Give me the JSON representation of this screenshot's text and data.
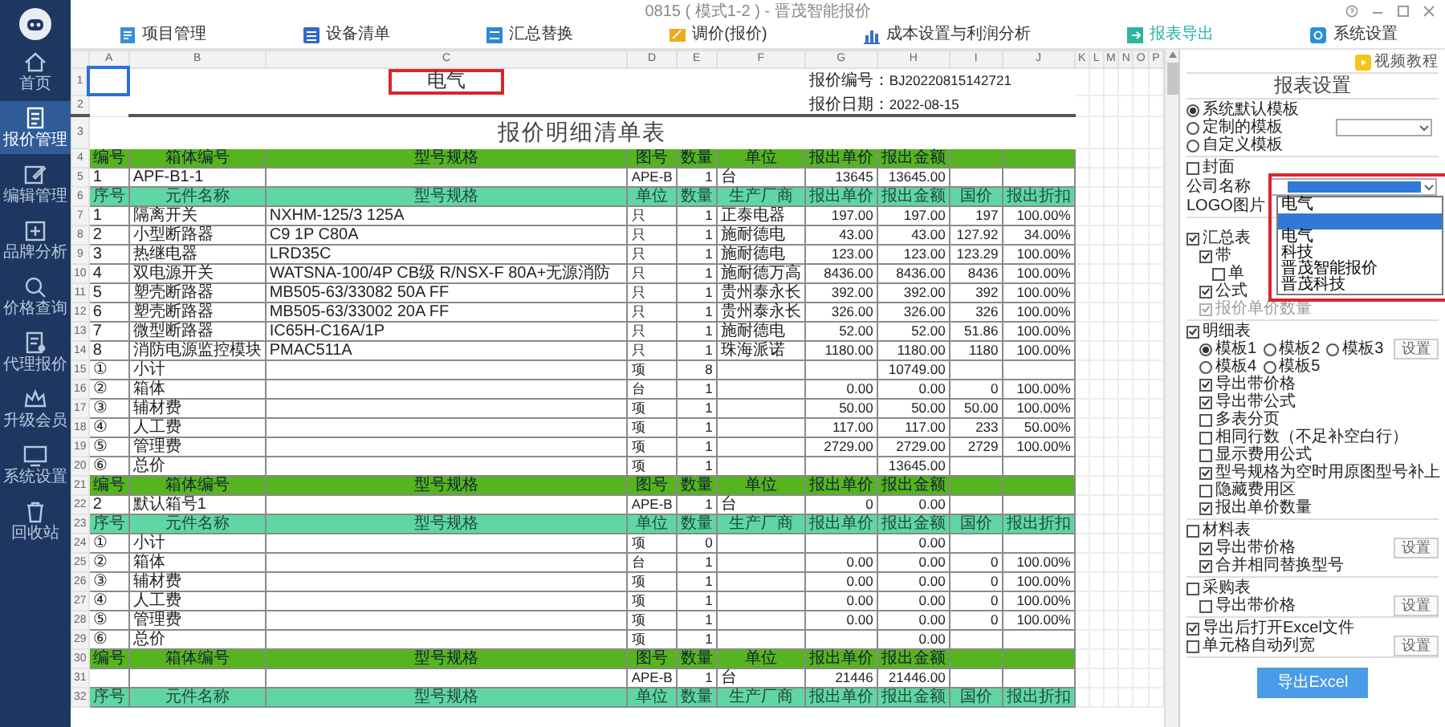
{
  "window": {
    "title": "0815 ( 模式1-2 ) - 晋茂智能报价"
  },
  "sidebar": {
    "items": [
      {
        "label": "首页",
        "selected": false
      },
      {
        "label": "报价管理",
        "selected": true
      },
      {
        "label": "编辑管理",
        "selected": false
      },
      {
        "label": "品牌分析",
        "selected": false
      },
      {
        "label": "价格查询",
        "selected": false
      },
      {
        "label": "代理报价",
        "selected": false
      },
      {
        "label": "升级会员",
        "selected": false
      },
      {
        "label": "系统设置",
        "selected": false
      },
      {
        "label": "回收站",
        "selected": false
      }
    ]
  },
  "toolbar": {
    "items": [
      {
        "label": "项目管理",
        "selected": false
      },
      {
        "label": "设备清单",
        "selected": false
      },
      {
        "label": "汇总替换",
        "selected": false
      },
      {
        "label": "调价(报价)",
        "selected": false
      },
      {
        "label": "成本设置与利润分析",
        "selected": false
      },
      {
        "label": "报表导出",
        "selected": true
      },
      {
        "label": "系统设置",
        "selected": false
      }
    ]
  },
  "sheet": {
    "column_letters": [
      "A",
      "B",
      "C",
      "D",
      "E",
      "F",
      "G",
      "H",
      "I",
      "J",
      "K",
      "L",
      "M",
      "N",
      "O",
      "P"
    ],
    "heading_row_numbers": [
      "1",
      "2",
      "3"
    ],
    "company_name": "电气",
    "quote_no_label": "报价编号：",
    "quote_no": "BJ20220815142721",
    "quote_date_label": "报价日期：",
    "quote_date": "2022-08-15",
    "title": "报价明细清单表",
    "rows": [
      {
        "number": "4",
        "kind": "box-header",
        "cells": {
          "A": "编号",
          "B": "箱体编号",
          "C": "型号规格",
          "D": "图号",
          "E": "数量",
          "F": "单位",
          "G": "报出单价",
          "H": "报出金额"
        }
      },
      {
        "number": "5",
        "kind": "data",
        "cells": {
          "A": "1",
          "B": "APF-B1-1",
          "D": "APE-B",
          "E": "1",
          "F": "台",
          "G": "13645",
          "H": "13645.00"
        }
      },
      {
        "number": "6",
        "kind": "item-header",
        "cells": {
          "A": "序号",
          "B": "元件名称",
          "C": "型号规格",
          "D": "单位",
          "E": "数量",
          "F": "生产厂商",
          "G": "报出单价",
          "H": "报出金额",
          "I": "国价",
          "J": "报出折扣"
        }
      },
      {
        "number": "7",
        "kind": "data",
        "cells": {
          "A": "1",
          "B": "隔离开关",
          "C": "NXHM-125/3 125A",
          "D": "只",
          "E": "1",
          "F": "正泰电器",
          "G": "197.00",
          "H": "197.00",
          "I": "197",
          "J": "100.00%"
        }
      },
      {
        "number": "8",
        "kind": "data",
        "cells": {
          "A": "2",
          "B": "小型断路器",
          "C": "C9 1P C80A",
          "D": "只",
          "E": "1",
          "F": "施耐德电",
          "G": "43.00",
          "H": "43.00",
          "I": "127.92",
          "J": "34.00%"
        }
      },
      {
        "number": "9",
        "kind": "data",
        "cells": {
          "A": "3",
          "B": "热继电器",
          "C": "LRD35C",
          "D": "只",
          "E": "1",
          "F": "施耐德电",
          "G": "123.00",
          "H": "123.00",
          "I": "123.29",
          "J": "100.00%"
        }
      },
      {
        "number": "10",
        "kind": "data",
        "cells": {
          "A": "4",
          "B": "双电源开关",
          "C": "WATSNA-100/4P CB级 R/NSX-F 80A+无源消防",
          "D": "只",
          "E": "1",
          "F": "施耐德万高",
          "G": "8436.00",
          "H": "8436.00",
          "I": "8436",
          "J": "100.00%"
        }
      },
      {
        "number": "11",
        "kind": "data",
        "cells": {
          "A": "5",
          "B": "塑壳断路器",
          "C": "MB505-63/33082 50A FF",
          "D": "只",
          "E": "1",
          "F": "贵州泰永长",
          "G": "392.00",
          "H": "392.00",
          "I": "392",
          "J": "100.00%"
        }
      },
      {
        "number": "12",
        "kind": "data",
        "cells": {
          "A": "6",
          "B": "塑壳断路器",
          "C": "MB505-63/33002 20A FF",
          "D": "只",
          "E": "1",
          "F": "贵州泰永长",
          "G": "326.00",
          "H": "326.00",
          "I": "326",
          "J": "100.00%"
        }
      },
      {
        "number": "13",
        "kind": "data",
        "cells": {
          "A": "7",
          "B": "微型断路器",
          "C": "IC65H-C16A/1P",
          "D": "只",
          "E": "1",
          "F": "施耐德电",
          "G": "52.00",
          "H": "52.00",
          "I": "51.86",
          "J": "100.00%"
        }
      },
      {
        "number": "14",
        "kind": "data",
        "cells": {
          "A": "8",
          "B": "消防电源监控模块",
          "C": "PMAC511A",
          "D": "只",
          "E": "1",
          "F": "珠海派诺",
          "G": "1180.00",
          "H": "1180.00",
          "I": "1180",
          "J": "100.00%"
        }
      },
      {
        "number": "15",
        "kind": "data",
        "cells": {
          "A": "①",
          "B": "小计",
          "D": "项",
          "E": "8",
          "H": "10749.00"
        }
      },
      {
        "number": "16",
        "kind": "data",
        "cells": {
          "A": "②",
          "B": "箱体",
          "D": "台",
          "E": "1",
          "G": "0.00",
          "H": "0.00",
          "I": "0",
          "J": "100.00%"
        }
      },
      {
        "number": "17",
        "kind": "data",
        "cells": {
          "A": "③",
          "B": "辅材费",
          "D": "项",
          "E": "1",
          "G": "50.00",
          "H": "50.00",
          "I": "50.00",
          "J": "100.00%"
        }
      },
      {
        "number": "18",
        "kind": "data",
        "cells": {
          "A": "④",
          "B": "人工费",
          "D": "项",
          "E": "1",
          "G": "117.00",
          "H": "117.00",
          "I": "233",
          "J": "50.00%"
        }
      },
      {
        "number": "19",
        "kind": "data",
        "cells": {
          "A": "⑤",
          "B": "管理费",
          "D": "项",
          "E": "1",
          "G": "2729.00",
          "H": "2729.00",
          "I": "2729",
          "J": "100.00%"
        }
      },
      {
        "number": "20",
        "kind": "data",
        "cells": {
          "A": "⑥",
          "B": "总价",
          "D": "项",
          "E": "1",
          "H": "13645.00"
        }
      },
      {
        "number": "21",
        "kind": "box-header",
        "cells": {
          "A": "编号",
          "B": "箱体编号",
          "C": "型号规格",
          "D": "图号",
          "E": "数量",
          "F": "单位",
          "G": "报出单价",
          "H": "报出金额"
        }
      },
      {
        "number": "22",
        "kind": "data",
        "cells": {
          "A": "2",
          "B": "默认箱号1",
          "D": "APE-B",
          "E": "1",
          "F": "台",
          "G": "0",
          "H": "0.00"
        }
      },
      {
        "number": "23",
        "kind": "item-header",
        "cells": {
          "A": "序号",
          "B": "元件名称",
          "C": "型号规格",
          "D": "单位",
          "E": "数量",
          "F": "生产厂商",
          "G": "报出单价",
          "H": "报出金额",
          "I": "国价",
          "J": "报出折扣"
        }
      },
      {
        "number": "24",
        "kind": "data",
        "cells": {
          "A": "①",
          "B": "小计",
          "D": "项",
          "E": "0",
          "H": "0.00"
        }
      },
      {
        "number": "25",
        "kind": "data",
        "cells": {
          "A": "②",
          "B": "箱体",
          "D": "台",
          "E": "1",
          "G": "0.00",
          "H": "0.00",
          "I": "0",
          "J": "100.00%"
        }
      },
      {
        "number": "26",
        "kind": "data",
        "cells": {
          "A": "③",
          "B": "辅材费",
          "D": "项",
          "E": "1",
          "G": "0.00",
          "H": "0.00",
          "I": "0",
          "J": "100.00%"
        }
      },
      {
        "number": "27",
        "kind": "data",
        "cells": {
          "A": "④",
          "B": "人工费",
          "D": "项",
          "E": "1",
          "G": "0.00",
          "H": "0.00",
          "I": "0",
          "J": "100.00%"
        }
      },
      {
        "number": "28",
        "kind": "data",
        "cells": {
          "A": "⑤",
          "B": "管理费",
          "D": "项",
          "E": "1",
          "G": "0.00",
          "H": "0.00",
          "I": "0",
          "J": "100.00%"
        }
      },
      {
        "number": "29",
        "kind": "data",
        "cells": {
          "A": "⑥",
          "B": "总价",
          "D": "项",
          "E": "1",
          "H": "0.00"
        }
      },
      {
        "number": "30",
        "kind": "box-header",
        "cells": {
          "A": "编号",
          "B": "箱体编号",
          "C": "型号规格",
          "D": "图号",
          "E": "数量",
          "F": "单位",
          "G": "报出单价",
          "H": "报出金额"
        }
      },
      {
        "number": "31",
        "kind": "data",
        "cells": {
          "D": "APE-B",
          "E": "1",
          "F": "台",
          "G": "21446",
          "H": "21446.00"
        }
      },
      {
        "number": "32",
        "kind": "item-header",
        "cells": {
          "A": "序号",
          "B": "元件名称",
          "C": "型号规格",
          "D": "单位",
          "E": "数量",
          "F": "生产厂商",
          "G": "报出单价",
          "H": "报出金额",
          "I": "国价",
          "J": "报出折扣"
        }
      }
    ]
  },
  "settings": {
    "video_button": "视频教程",
    "title": "报表设置",
    "templates": [
      {
        "label": "系统默认模板",
        "selected": true,
        "kind": "plain"
      },
      {
        "label": "定制的模板",
        "selected": false,
        "kind": "with-select"
      },
      {
        "label": "自定义模板",
        "selected": false,
        "kind": "plain"
      }
    ],
    "cover": {
      "label": "封面",
      "checked": false,
      "company_label": "公司名称",
      "logo_label": "LOGO图片",
      "company_options": [
        {
          "label": "电气",
          "selected": false
        },
        {
          "selected": true
        },
        {
          "label": "电气",
          "selected": false
        },
        {
          "label": "科技",
          "selected": false
        },
        {
          "label": "晋茂智能报价",
          "selected": false
        },
        {
          "label": "晋茂科技",
          "selected": false
        }
      ]
    },
    "sections": [
      {
        "items": [
          {
            "kind": "checkbox",
            "label": "汇总表",
            "checked": true,
            "disabled": false,
            "children": [
              {
                "kind": "checkbox",
                "label": "带",
                "checked": true,
                "disabled": false,
                "children": [
                  {
                    "kind": "checkbox",
                    "label": "单",
                    "checked": false,
                    "disabled": false
                  }
                ]
              },
              {
                "kind": "checkbox",
                "label": "公式",
                "checked": true,
                "disabled": false
              },
              {
                "kind": "checkbox",
                "label": "报价单价数量",
                "checked": true,
                "disabled": true
              }
            ]
          }
        ]
      },
      {
        "items": [
          {
            "kind": "checkbox",
            "label": "明细表",
            "checked": true,
            "disabled": false,
            "children": [
              {
                "kind": "radios",
                "options": [
                  {
                    "label": "模板1",
                    "selected": true
                  },
                  {
                    "label": "模板2",
                    "selected": false
                  },
                  {
                    "label": "模板3",
                    "selected": false
                  }
                ],
                "button": "设置"
              },
              {
                "kind": "radios",
                "options": [
                  {
                    "label": "模板4",
                    "selected": false
                  },
                  {
                    "label": "模板5",
                    "selected": false
                  }
                ]
              },
              {
                "kind": "checkbox",
                "label": "导出带价格",
                "checked": true,
                "disabled": false
              },
              {
                "kind": "checkbox",
                "label": "导出带公式",
                "checked": true,
                "disabled": false
              },
              {
                "kind": "checkbox",
                "label": "多表分页",
                "checked": false,
                "disabled": false
              },
              {
                "kind": "checkbox",
                "label": "相同行数（不足补空白行）",
                "checked": false,
                "disabled": false
              },
              {
                "kind": "checkbox",
                "label": "显示费用公式",
                "checked": false,
                "disabled": false
              },
              {
                "kind": "checkbox",
                "label": "型号规格为空时用原图型号补上",
                "checked": true,
                "disabled": false
              },
              {
                "kind": "checkbox",
                "label": "隐藏费用区",
                "checked": false,
                "disabled": false
              },
              {
                "kind": "checkbox",
                "label": "报出单价数量",
                "checked": true,
                "disabled": false
              }
            ]
          }
        ]
      },
      {
        "items": [
          {
            "kind": "checkbox",
            "label": "材料表",
            "checked": false,
            "disabled": false,
            "children": [
              {
                "kind": "checkbox",
                "label": "导出带价格",
                "checked": true,
                "disabled": false,
                "button": "设置"
              },
              {
                "kind": "checkbox",
                "label": "合并相同替换型号",
                "checked": true,
                "disabled": false
              }
            ]
          }
        ]
      },
      {
        "items": [
          {
            "kind": "checkbox",
            "label": "采购表",
            "checked": false,
            "disabled": false,
            "children": [
              {
                "kind": "checkbox",
                "label": "导出带价格",
                "checked": false,
                "disabled": false,
                "button": "设置"
              }
            ]
          }
        ]
      },
      {
        "items": [
          {
            "kind": "checkbox",
            "label": "导出后打开Excel文件",
            "checked": true,
            "disabled": false
          },
          {
            "kind": "checkbox",
            "label": "单元格自动列宽",
            "checked": false,
            "disabled": false,
            "button": "设置"
          }
        ]
      }
    ],
    "export_button": "导出Excel"
  }
}
